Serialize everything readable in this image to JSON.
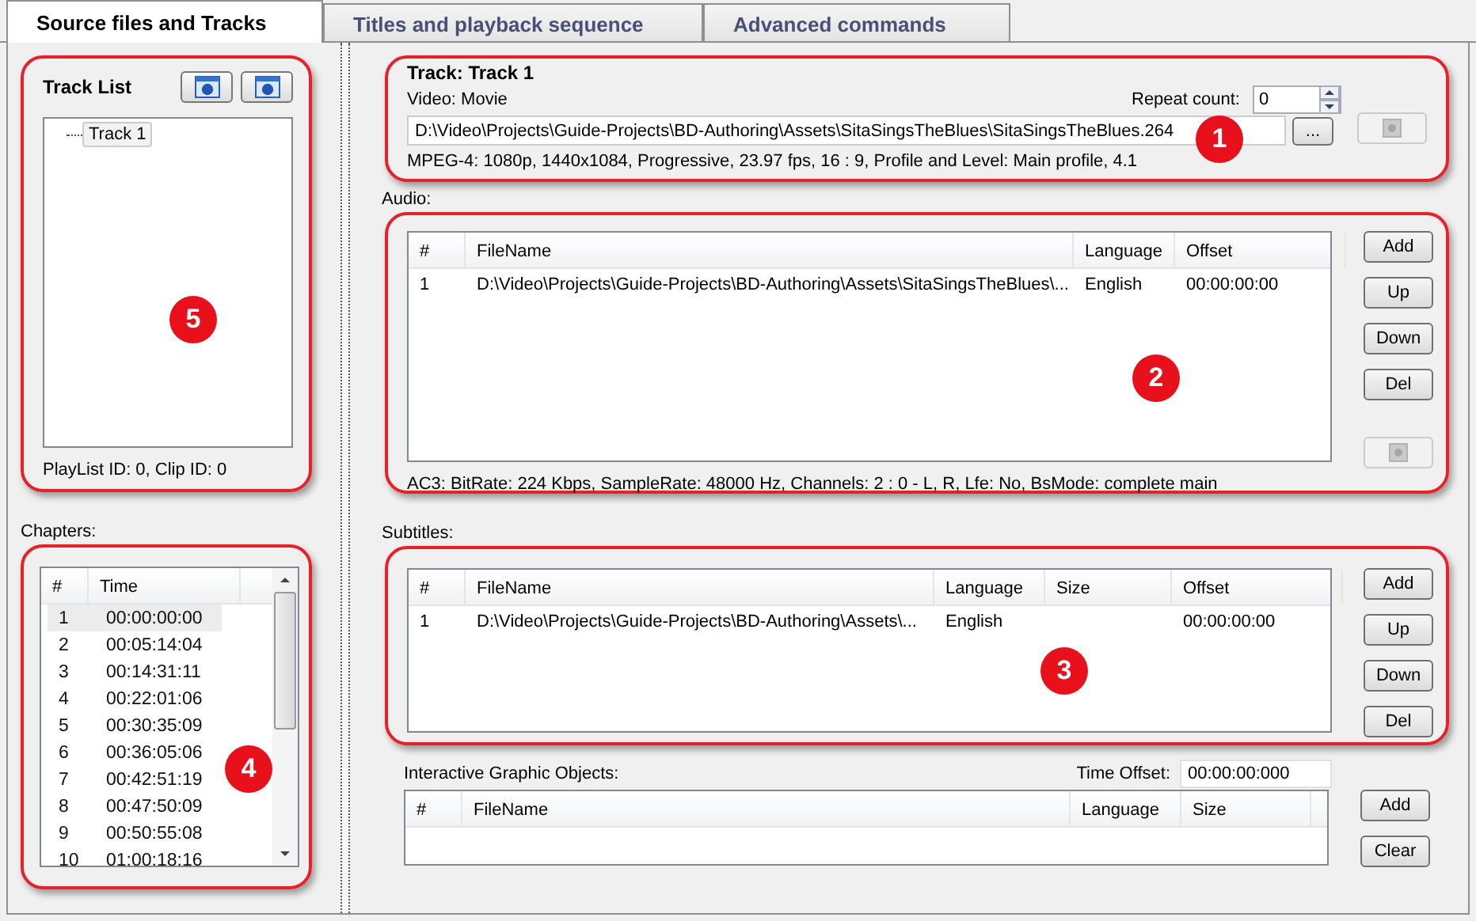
{
  "tabs": [
    {
      "label": "Source files and Tracks",
      "selected": true
    },
    {
      "label": "Titles and playback sequence",
      "selected": false
    },
    {
      "label": "Advanced commands",
      "selected": false
    }
  ],
  "track_list": {
    "title": "Track List",
    "callout": "5",
    "help_buttons": [
      {
        "disabled": false
      },
      {
        "disabled": false
      }
    ],
    "items": [
      {
        "label": "Track 1",
        "selected": true
      }
    ],
    "ids": "PlayList ID: 0, Clip ID: 0"
  },
  "chapters": {
    "label": "Chapters:",
    "callout": "4",
    "columns": [
      "#",
      "Time"
    ],
    "rows": [
      {
        "cells": [
          "1",
          "00:00:00:00"
        ],
        "selected": true
      },
      {
        "cells": [
          "2",
          "00:05:14:04"
        ],
        "selected": false
      },
      {
        "cells": [
          "3",
          "00:14:31:11"
        ],
        "selected": false
      },
      {
        "cells": [
          "4",
          "00:22:01:06"
        ],
        "selected": false
      },
      {
        "cells": [
          "5",
          "00:30:35:09"
        ],
        "selected": false
      },
      {
        "cells": [
          "6",
          "00:36:05:06"
        ],
        "selected": false
      },
      {
        "cells": [
          "7",
          "00:42:51:19"
        ],
        "selected": false
      },
      {
        "cells": [
          "8",
          "00:47:50:09"
        ],
        "selected": false
      },
      {
        "cells": [
          "9",
          "00:50:55:08"
        ],
        "selected": false
      },
      {
        "cells": [
          "10",
          "01:00:18:16"
        ],
        "selected": false
      }
    ]
  },
  "track": {
    "title": "Track: Track 1",
    "callout": "1",
    "video_label": "Video: Movie",
    "repeat_label": "Repeat count:",
    "repeat_value": "0",
    "path": "D:\\Video\\Projects\\Guide-Projects\\BD-Authoring\\Assets\\SitaSingsTheBlues\\SitaSingsTheBlues.264",
    "browse": "...",
    "info": "MPEG-4: 1080p,  1440x1084,  Progressive,  23.97 fps,  16 : 9,  Profile and Level: Main profile,  4.1",
    "help_button": {
      "disabled": true
    }
  },
  "audio": {
    "label": "Audio:",
    "callout": "2",
    "columns": [
      "#",
      "FileName",
      "Language",
      "Offset"
    ],
    "rows": [
      {
        "cells": [
          "1",
          "D:\\Video\\Projects\\Guide-Projects\\BD-Authoring\\Assets\\SitaSingsTheBlues\\...",
          "English",
          "00:00:00:00"
        ]
      }
    ],
    "buttons": [
      "Add",
      "Up",
      "Down",
      "Del"
    ],
    "help_button": {
      "disabled": true
    },
    "info": "AC3: BitRate: 224 Kbps, SampleRate: 48000 Hz, Channels: 2 : 0 - L, R, Lfe: No, BsMode: complete main"
  },
  "subtitles": {
    "label": "Subtitles:",
    "callout": "3",
    "columns": [
      "#",
      "FileName",
      "Language",
      "Size",
      "Offset"
    ],
    "rows": [
      {
        "cells": [
          "1",
          "D:\\Video\\Projects\\Guide-Projects\\BD-Authoring\\Assets\\...",
          "English",
          "",
          "00:00:00:00"
        ]
      }
    ],
    "buttons": [
      "Add",
      "Up",
      "Down",
      "Del"
    ]
  },
  "igo": {
    "label": "Interactive Graphic Objects:",
    "time_offset_label": "Time Offset:",
    "time_offset": "00:00:00:000",
    "columns": [
      "#",
      "FileName",
      "Language",
      "Size"
    ],
    "buttons": [
      "Add",
      "Clear"
    ]
  }
}
